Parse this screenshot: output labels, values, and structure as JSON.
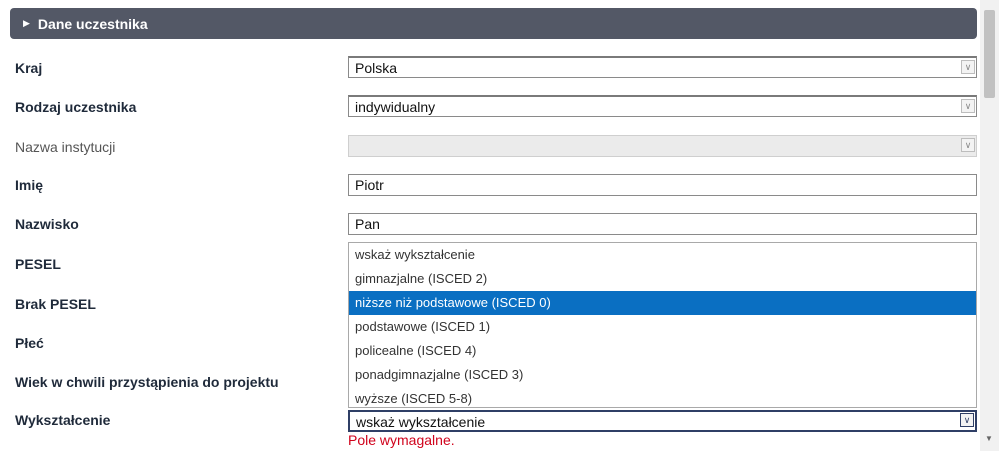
{
  "section": {
    "title": "Dane uczestnika",
    "caret_icon": "triangle-right-icon"
  },
  "fields": {
    "kraj": {
      "label": "Kraj",
      "value": "Polska"
    },
    "rodzaj": {
      "label": "Rodzaj uczestnika",
      "value": "indywidualny"
    },
    "instytucja": {
      "label": "Nazwa instytucji",
      "value": ""
    },
    "imie": {
      "label": "Imię",
      "value": "Piotr"
    },
    "nazwisko": {
      "label": "Nazwisko",
      "value": "Pan"
    },
    "pesel": {
      "label": "PESEL"
    },
    "brak_pesel": {
      "label": "Brak PESEL"
    },
    "plec": {
      "label": "Płeć"
    },
    "wiek": {
      "label": "Wiek w chwili przystąpienia do projektu"
    },
    "wyksztalcenie": {
      "label": "Wykształcenie",
      "value": "wskaż wykształcenie",
      "error": "Pole wymagalne."
    }
  },
  "dropdown": {
    "options": [
      "wskaż wykształcenie",
      "gimnazjalne (ISCED 2)",
      "niższe niż podstawowe (ISCED 0)",
      "podstawowe (ISCED 1)",
      "policealne (ISCED 4)",
      "ponadgimnazjalne (ISCED 3)",
      "wyższe (ISCED 5-8)"
    ],
    "highlighted_index": 2
  },
  "colors": {
    "header_bg": "#535866",
    "highlight": "#0a6fc2",
    "error": "#d0021b"
  }
}
